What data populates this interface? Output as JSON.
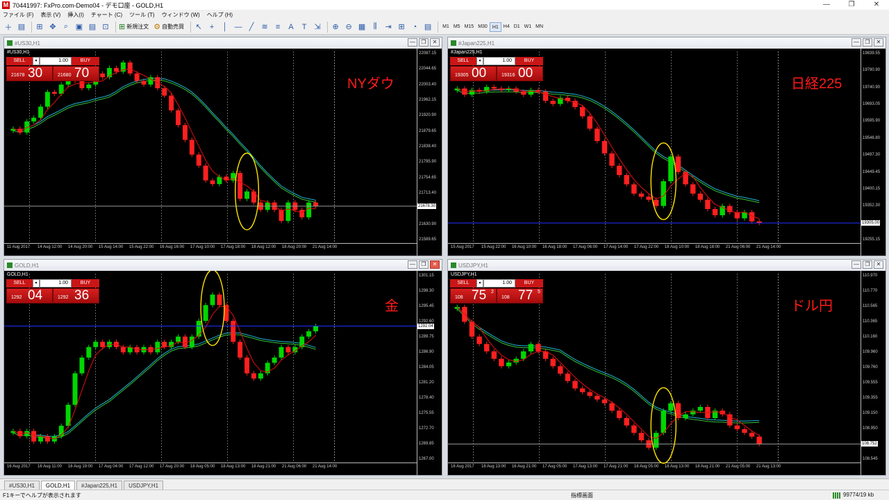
{
  "window": {
    "title": "70441997: FxPro.com-Demo04 - デモ口座 - GOLD,H1",
    "min": "—",
    "restore": "❐",
    "close": "✕"
  },
  "menu": [
    "ファイル (F)",
    "表示 (V)",
    "挿入(I)",
    "チャート (C)",
    "ツール (T)",
    "ウィンドウ (W)",
    "ヘルプ (H)"
  ],
  "toolbar": {
    "new_order": "新規注文",
    "auto_trading": "自動売買",
    "timeframes": [
      "M1",
      "M5",
      "M15",
      "M30",
      "H1",
      "H4",
      "D1",
      "W1",
      "MN"
    ],
    "active_timeframe": "H1",
    "tool_glyphs": [
      "＋",
      "▤",
      "⊞",
      "✥",
      "⌕",
      "▣",
      "▤",
      "⊡"
    ],
    "draw_glyphs": [
      "↖",
      "+",
      "│",
      "—",
      "╱",
      "≋",
      "≡",
      "A",
      "T",
      "⇲"
    ],
    "view_glyphs": [
      "⊕",
      "⊖",
      "▦",
      "⫼",
      "⇥",
      "⊞",
      "◔",
      "▤"
    ]
  },
  "charts": [
    {
      "id": "us30",
      "title": "#US30,H1",
      "symbol_label": "#US30,H1",
      "market_label": "NYダウ",
      "sell": {
        "label": "SELL",
        "small": "21678",
        "big": "30",
        "sup": ""
      },
      "buy": {
        "label": "BUY",
        "small": "21680",
        "big": "70",
        "sup": ""
      },
      "lot": "1.00",
      "y_ticks": [
        "22087.15",
        "22044.65",
        "22003.40",
        "21962.15",
        "21920.90",
        "21879.65",
        "21838.40",
        "21795.90",
        "21754.65",
        "21713.40",
        "21672.15",
        "21630.90",
        "21589.65"
      ],
      "x_ticks": [
        "11 Aug 2017",
        "14 Aug 12:00",
        "14 Aug 20:00",
        "15 Aug 14:00",
        "15 Aug 22:00",
        "16 Aug 16:00",
        "17 Aug 10:00",
        "17 Aug 18:00",
        "18 Aug 12:00",
        "18 Aug 20:00",
        "21 Aug 14:00"
      ],
      "current_price": "21678.30",
      "chart_data": {
        "type": "candlestick",
        "ylim": [
          21580,
          22100
        ],
        "ma_fast_color": "#e01010",
        "ma_slow_colors": [
          "#1fb9d6",
          "#37c437"
        ],
        "close": [
          21890,
          21880,
          21910,
          21920,
          21950,
          21990,
          21985,
          22010,
          22030,
          22020,
          22000,
          22010,
          22040,
          22030,
          22055,
          22045,
          22070,
          22040,
          22020,
          22010,
          22030,
          22000,
          21980,
          21940,
          21900,
          21860,
          21820,
          21790,
          21750,
          21740,
          21760,
          21750,
          21770,
          21700,
          21720,
          21690,
          21670,
          21690,
          21670,
          21640,
          21690,
          21670,
          21650,
          21690,
          21680
        ]
      },
      "highlight_label": ""
    },
    {
      "id": "jp225",
      "title": "#Japan225,H1",
      "symbol_label": "#Japan225,H1",
      "market_label": "日経225",
      "sell": {
        "label": "SELL",
        "small": "19305",
        "big": "00",
        "sup": ""
      },
      "buy": {
        "label": "BUY",
        "small": "19316",
        "big": "00",
        "sup": ""
      },
      "lot": "1.00",
      "y_ticks": [
        "19839.55",
        "19790.90",
        "19740.90",
        "19693.05",
        "19595.90",
        "19546.80",
        "19497.30",
        "19449.45",
        "19400.15",
        "19352.30",
        "19305.00",
        "19255.15"
      ],
      "x_ticks": [
        "15 Aug 2017",
        "15 Aug 22:00",
        "16 Aug 10:00",
        "16 Aug 18:00",
        "17 Aug 06:00",
        "17 Aug 14:00",
        "17 Aug 22:00",
        "18 Aug 10:00",
        "18 Aug 18:00",
        "21 Aug 06:00",
        "21 Aug 14:00"
      ],
      "current_price": "19305.00",
      "chart_data": {
        "type": "candlestick",
        "ylim": [
          19240,
          19860
        ],
        "ma_fast_color": "#e01010",
        "ma_slow_colors": [
          "#1fb9d6",
          "#37c437"
        ],
        "close": [
          19740,
          19720,
          19735,
          19730,
          19745,
          19740,
          19735,
          19740,
          19730,
          19720,
          19735,
          19730,
          19700,
          19690,
          19710,
          19700,
          19680,
          19650,
          19610,
          19570,
          19530,
          19490,
          19460,
          19430,
          19400,
          19390,
          19380,
          19360,
          19440,
          19520,
          19470,
          19430,
          19400,
          19380,
          19350,
          19330,
          19360,
          19340,
          19320,
          19340,
          19310,
          19305
        ]
      },
      "highlight_label": ""
    },
    {
      "id": "gold",
      "title": "GOLD,H1",
      "symbol_label": "GOLD,H1",
      "market_label": "金",
      "sell": {
        "label": "SELL",
        "small": "1292",
        "big": "04",
        "sup": ""
      },
      "buy": {
        "label": "BUY",
        "small": "1292",
        "big": "36",
        "sup": ""
      },
      "lot": "1.00",
      "y_ticks": [
        "1301.15",
        "1298.30",
        "1295.45",
        "1292.60",
        "1289.75",
        "1286.90",
        "1284.05",
        "1281.20",
        "1278.40",
        "1275.55",
        "1272.70",
        "1269.85",
        "1267.00"
      ],
      "x_ticks": [
        "16 Aug 2017",
        "16 Aug 11:00",
        "16 Aug 19:00",
        "17 Aug 04:00",
        "17 Aug 12:00",
        "17 Aug 20:00",
        "18 Aug 05:00",
        "18 Aug 13:00",
        "18 Aug 21:00",
        "21 Aug 06:00",
        "21 Aug 14:00"
      ],
      "current_price": "1292.04",
      "chart_data": {
        "type": "candlestick",
        "ylim": [
          1266,
          1302
        ],
        "ma_fast_color": "#e01010",
        "ma_slow_colors": [
          "#1fb9d6",
          "#37c437"
        ],
        "close": [
          1272,
          1271,
          1272,
          1270,
          1271,
          1270,
          1271,
          1273,
          1277,
          1283,
          1286,
          1288,
          1289,
          1288,
          1289,
          1288,
          1287,
          1288,
          1287,
          1288,
          1287,
          1289,
          1288,
          1289,
          1290,
          1288,
          1290,
          1293,
          1296,
          1298,
          1296,
          1293,
          1289,
          1286,
          1283,
          1282,
          1283,
          1285,
          1286,
          1288,
          1287,
          1288,
          1290,
          1291,
          1292
        ]
      },
      "highlight_label": ""
    },
    {
      "id": "usdjpy",
      "title": "USDJPY,H1",
      "symbol_label": "USDJPY,H1",
      "market_label": "ドル円",
      "sell": {
        "label": "SELL",
        "small": "108",
        "big": "75",
        "sup": "2"
      },
      "buy": {
        "label": "BUY",
        "small": "108",
        "big": "77",
        "sup": "5"
      },
      "lot": "1.00",
      "y_ticks": [
        "110.970",
        "110.770",
        "110.565",
        "110.365",
        "110.160",
        "109.960",
        "109.760",
        "109.555",
        "109.355",
        "109.150",
        "108.950",
        "108.752",
        "108.545"
      ],
      "x_ticks": [
        "16 Aug 2017",
        "16 Aug 13:00",
        "16 Aug 21:00",
        "17 Aug 05:00",
        "17 Aug 13:00",
        "17 Aug 21:00",
        "18 Aug 05:00",
        "18 Aug 13:00",
        "18 Aug 21:00",
        "21 Aug 05:00",
        "21 Aug 13:00"
      ],
      "current_price": "108.752",
      "chart_data": {
        "type": "candlestick",
        "ylim": [
          108.5,
          111.05
        ],
        "ma_fast_color": "#e01010",
        "ma_slow_colors": [
          "#1fb9d6",
          "#37c437"
        ],
        "close": [
          110.6,
          110.4,
          110.2,
          110.1,
          110.0,
          109.9,
          109.8,
          109.85,
          109.9,
          110.0,
          110.1,
          110.0,
          109.9,
          109.8,
          109.7,
          109.6,
          109.5,
          109.45,
          109.4,
          109.35,
          109.3,
          109.2,
          109.1,
          109.0,
          108.9,
          108.8,
          108.7,
          108.9,
          109.2,
          109.3,
          109.1,
          109.15,
          109.2,
          109.25,
          109.1,
          109.2,
          109.15,
          109.0,
          108.95,
          108.9,
          108.85,
          108.75
        ]
      },
      "highlight_label": ""
    }
  ],
  "tabs": [
    "#US30,H1",
    "GOLD,H1",
    "#Japan225,H1",
    "USDJPY,H1"
  ],
  "active_tab": "GOLD,H1",
  "status": {
    "help": "F1キーでヘルプが表示されます",
    "profile": "指標画面",
    "traffic": "99774/19 kb"
  }
}
